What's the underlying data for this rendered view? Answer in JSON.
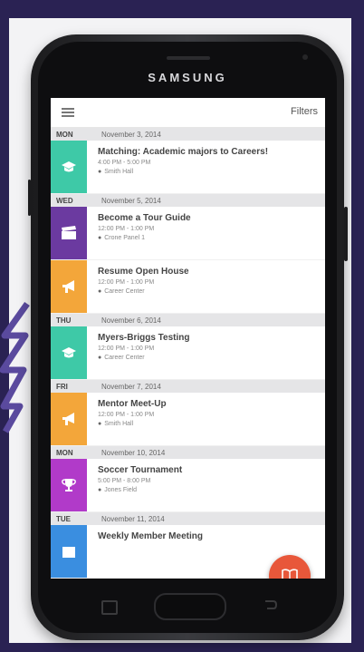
{
  "app": {
    "filters_label": "Filters"
  },
  "phone": {
    "brand": "SAMSUNG"
  },
  "agenda": [
    {
      "dow": "MON",
      "date": "November 3, 2014",
      "events": [
        {
          "title": "Matching: Academic majors to Careers!",
          "time": "4:00 PM - 5:00 PM",
          "location": "Smith Hall",
          "color": "#3ec9a7",
          "icon": "graduation-cap-icon"
        }
      ]
    },
    {
      "dow": "WED",
      "date": "November 5, 2014",
      "events": [
        {
          "title": "Become a Tour Guide",
          "time": "12:00 PM - 1:00 PM",
          "location": "Crone Panel 1",
          "color": "#6b3aa0",
          "icon": "clapperboard-icon"
        },
        {
          "title": "Resume Open House",
          "time": "12:00 PM - 1:00 PM",
          "location": "Career Center",
          "color": "#f3a63a",
          "icon": "megaphone-icon"
        }
      ]
    },
    {
      "dow": "THU",
      "date": "November 6, 2014",
      "events": [
        {
          "title": "Myers-Briggs Testing",
          "time": "12:00 PM - 1:00 PM",
          "location": "Career Center",
          "color": "#3ec9a7",
          "icon": "graduation-cap-icon"
        }
      ]
    },
    {
      "dow": "FRI",
      "date": "November 7, 2014",
      "events": [
        {
          "title": "Mentor Meet-Up",
          "time": "12:00 PM - 1:00 PM",
          "location": "Smith Hall",
          "color": "#f3a63a",
          "icon": "megaphone-icon"
        }
      ]
    },
    {
      "dow": "MON",
      "date": "November 10, 2014",
      "events": [
        {
          "title": "Soccer Tournament",
          "time": "5:00 PM - 8:00 PM",
          "location": "Jones Field",
          "color": "#b13ac9",
          "icon": "trophy-icon"
        }
      ]
    },
    {
      "dow": "TUE",
      "date": "November 11, 2014",
      "events": [
        {
          "title": "Weekly Member Meeting",
          "time": "",
          "location": "",
          "color": "#3a8ee0",
          "icon": "calendar-icon"
        }
      ]
    }
  ],
  "fab": {
    "color": "#e8573a",
    "icon": "book-icon"
  }
}
